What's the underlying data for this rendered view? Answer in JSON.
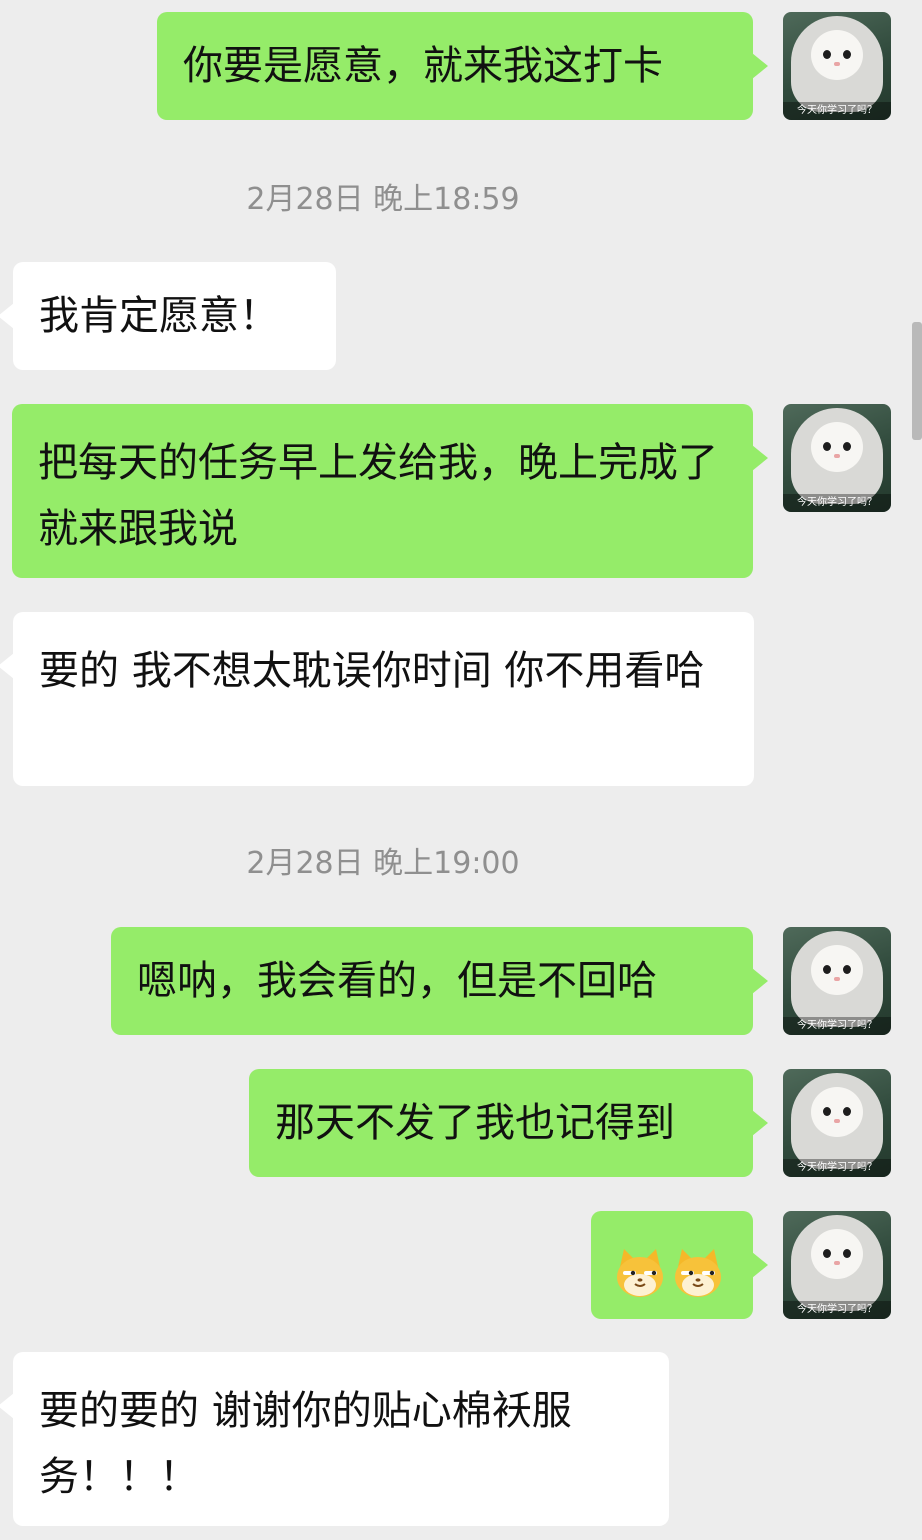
{
  "timestamps": [
    "2月28日 晚上18:59",
    "2月28日 晚上19:00"
  ],
  "avatar": {
    "caption": "今天你学习了吗？"
  },
  "emoji": {
    "name": "doge-cat-emoji",
    "count": 2
  },
  "messages": [
    {
      "from": "me",
      "text": "你要是愿意，就来我这打卡"
    },
    {
      "from": "other",
      "text": "我肯定愿意！"
    },
    {
      "from": "me",
      "text": "把每天的任务早上发给我，晚上完成了就来跟我说"
    },
    {
      "from": "other",
      "text": "要的 我不想太耽误你时间 你不用看哈"
    },
    {
      "from": "me",
      "text": "嗯呐，我会看的，但是不回哈"
    },
    {
      "from": "me",
      "text": "那天不发了我也记得到"
    },
    {
      "from": "me",
      "text": ""
    },
    {
      "from": "other",
      "text": "要的要的 谢谢你的贴心棉袄服务！！！"
    }
  ],
  "colors": {
    "background": "#ededed",
    "outgoing_bubble": "#95ec69",
    "incoming_bubble": "#ffffff",
    "timestamp_text": "#8f8f8f"
  }
}
